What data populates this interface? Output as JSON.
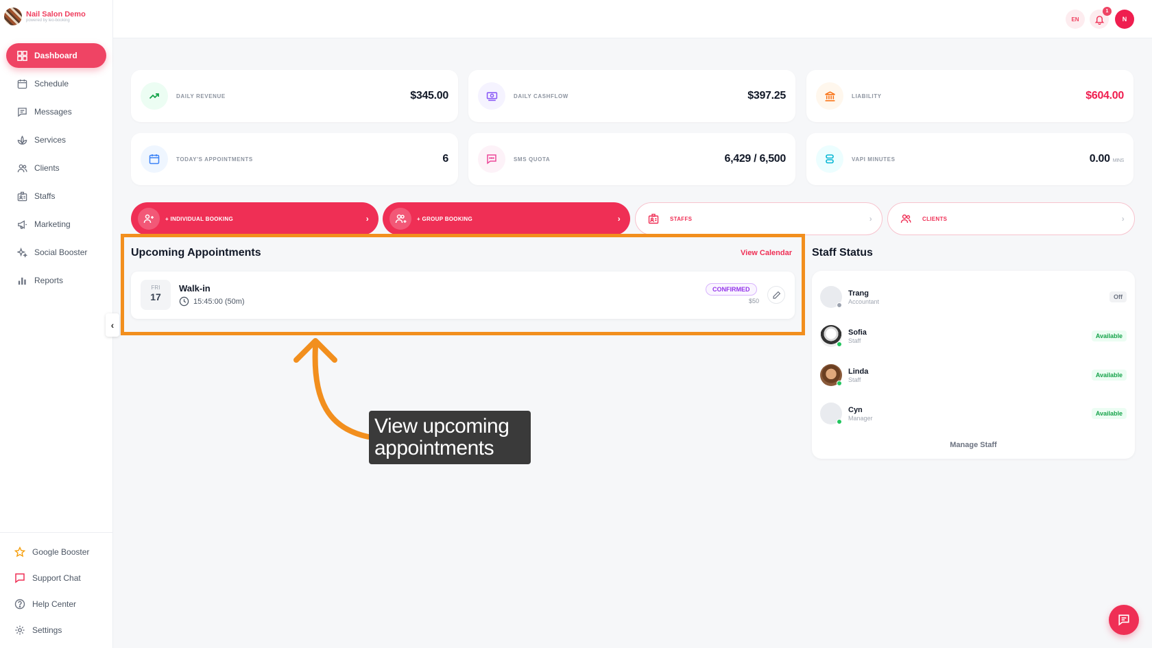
{
  "brand": {
    "name": "Nail Salon Demo",
    "subtitle": "powered by leo-booking"
  },
  "sidebar": {
    "items": [
      {
        "label": "Dashboard",
        "icon": "dashboard-icon"
      },
      {
        "label": "Schedule",
        "icon": "calendar-icon"
      },
      {
        "label": "Messages",
        "icon": "message-icon"
      },
      {
        "label": "Services",
        "icon": "lotus-icon"
      },
      {
        "label": "Clients",
        "icon": "users-icon"
      },
      {
        "label": "Staffs",
        "icon": "id-card-icon"
      },
      {
        "label": "Marketing",
        "icon": "megaphone-icon"
      },
      {
        "label": "Social Booster",
        "icon": "sparkles-icon"
      },
      {
        "label": "Reports",
        "icon": "bar-chart-icon"
      }
    ],
    "bottom_items": [
      {
        "label": "Google Booster",
        "icon": "star-icon"
      },
      {
        "label": "Support Chat",
        "icon": "chat-icon"
      },
      {
        "label": "Help Center",
        "icon": "help-icon"
      },
      {
        "label": "Settings",
        "icon": "gear-icon"
      }
    ]
  },
  "topbar": {
    "language": "EN",
    "notification_count": "1",
    "user_initial": "N"
  },
  "stats": {
    "daily_revenue": {
      "label": "Daily Revenue",
      "value": "$345.00"
    },
    "daily_cashflow": {
      "label": "Daily Cashflow",
      "value": "$397.25"
    },
    "liability": {
      "label": "Liability",
      "value": "$604.00"
    },
    "todays_appointments": {
      "label": "Today's Appointments",
      "value": "6"
    },
    "sms_quota": {
      "label": "SMS Quota",
      "value": "6,429 / 6,500"
    },
    "vapi_minutes": {
      "label": "Vapi Minutes",
      "value": "0.00",
      "unit": "MINS"
    }
  },
  "actions": {
    "individual_booking": "+ Individual Booking",
    "group_booking": "+ Group Booking",
    "staffs": "Staffs",
    "clients": "Clients"
  },
  "upcoming": {
    "title": "Upcoming Appointments",
    "view_calendar": "View Calendar",
    "appointment": {
      "day_of_week": "FRI",
      "day": "17",
      "title": "Walk-in",
      "time": "15:45:00 (50m)",
      "status": "CONFIRMED",
      "price": "$50"
    }
  },
  "annotation": {
    "text": "View upcoming appointments"
  },
  "staff_status": {
    "title": "Staff Status",
    "manage_label": "Manage Staff",
    "staff": [
      {
        "name": "Trang",
        "role": "Accountant",
        "status": "Off"
      },
      {
        "name": "Sofia",
        "role": "Staff",
        "status": "Available"
      },
      {
        "name": "Linda",
        "role": "Staff",
        "status": "Available"
      },
      {
        "name": "Cyn",
        "role": "Manager",
        "status": "Available"
      }
    ]
  },
  "colors": {
    "accent": "#ef2f55",
    "highlight": "#f28f1e",
    "confirmed": "#9333ea",
    "available": "#16a34a"
  }
}
